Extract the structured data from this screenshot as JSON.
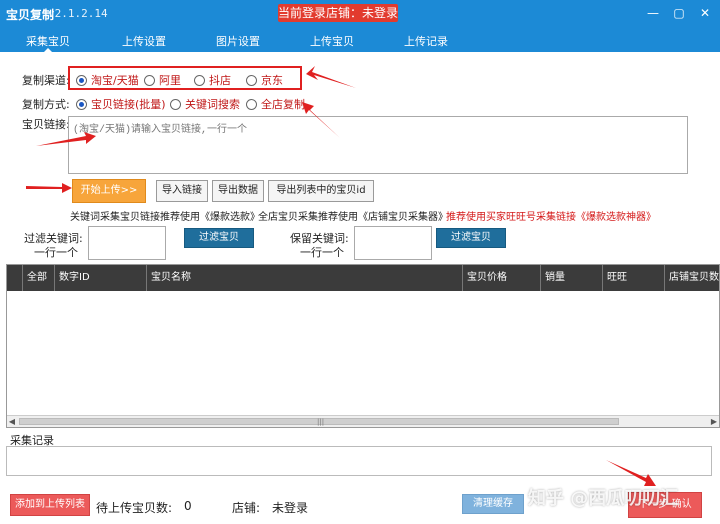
{
  "window": {
    "app_title": "宝贝复制",
    "version": "v2.1.2.14",
    "login_banner": "当前登录店铺：未登录",
    "controls": {
      "minimize": "—",
      "restore": "▢",
      "close": "✕"
    }
  },
  "tabs": [
    {
      "label": "采集宝贝",
      "active": true
    },
    {
      "label": "上传设置"
    },
    {
      "label": "图片设置"
    },
    {
      "label": "上传宝贝"
    },
    {
      "label": "上传记录"
    }
  ],
  "form": {
    "channel_label": "复制渠道:",
    "channels": [
      "淘宝/天猫",
      "阿里",
      "抖店",
      "京东"
    ],
    "method_label": "复制方式:",
    "methods": [
      "宝贝链接(批量)",
      "关键词搜索",
      "全店复制"
    ],
    "link_label": "宝贝链接:",
    "link_placeholder": "(淘宝/天猫)请输入宝贝链接,一行一个"
  },
  "buttons": {
    "start_upload": "开始上传>>",
    "import_links": "导入链接",
    "export_data": "导出数据",
    "export_ids": "导出列表中的宝贝id",
    "filter_items": "过滤宝贝",
    "keep_items": "过滤宝贝",
    "add_to_list": "添加到上传列表",
    "clear_cache": "清理缓存",
    "next_step": "下一步 确认"
  },
  "hints": {
    "keyword_tip": "关键词采集宝贝链接推荐使用《爆款选款》",
    "shop_tip": "全店宝贝采集推荐使用《店铺宝贝采集器》",
    "buyer_tip": "推荐使用买家旺旺号采集链接《爆款选款神器》"
  },
  "filters": {
    "filter_label_1": "过滤关键词:",
    "filter_label_2": "一行一个",
    "keep_label_1": "保留关键词:",
    "keep_label_2": "一行一个"
  },
  "table": {
    "columns": [
      "",
      "全部",
      "数字ID",
      "宝贝名称",
      "宝贝价格",
      "销量",
      "旺旺",
      "店铺宝贝数"
    ]
  },
  "log": {
    "label": "采集记录"
  },
  "footer": {
    "pending_label": "待上传宝贝数:",
    "pending_count": "0",
    "shop_label": "店铺:",
    "shop_value": "未登录",
    "watermark": "知乎 @西瓜叨叨汇"
  }
}
